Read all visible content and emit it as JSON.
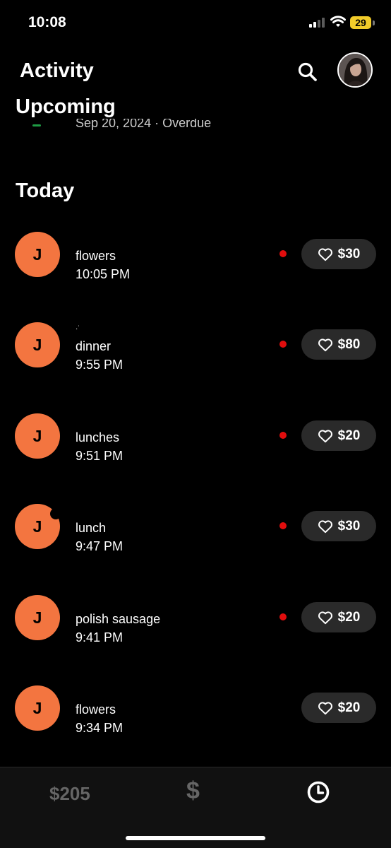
{
  "status_bar": {
    "time": "10:08",
    "battery": "29"
  },
  "header": {
    "title": "Activity"
  },
  "upcoming": {
    "heading": "Upcoming",
    "item_subtitle": "Sep 20, 2024 · Overdue"
  },
  "today": {
    "heading": "Today",
    "items": [
      {
        "initial": "J",
        "note": "flowers",
        "time": "10:05 PM",
        "amount": "$30",
        "unread": true
      },
      {
        "initial": "J",
        "note": "dinner",
        "time": "9:55 PM",
        "amount": "$80",
        "unread": true
      },
      {
        "initial": "J",
        "note": "lunches",
        "time": "9:51 PM",
        "amount": "$20",
        "unread": true
      },
      {
        "initial": "J",
        "note": "lunch",
        "time": "9:47 PM",
        "amount": "$30",
        "unread": true
      },
      {
        "initial": "J",
        "note": "polish sausage",
        "time": "9:41 PM",
        "amount": "$20",
        "unread": true
      },
      {
        "initial": "J",
        "note": "flowers",
        "time": "9:34 PM",
        "amount": "$20",
        "unread": false
      }
    ]
  },
  "tabbar": {
    "balance": "$205",
    "cash_symbol": "$"
  },
  "colors": {
    "avatar_bg": "#f37540",
    "unread_dot": "#e10d0d",
    "pill_bg": "#2a2a2a",
    "battery": "#f2cc2a"
  },
  "icons": [
    "search-icon",
    "heart-icon",
    "clock-icon",
    "wifi-icon",
    "signal-icon"
  ]
}
